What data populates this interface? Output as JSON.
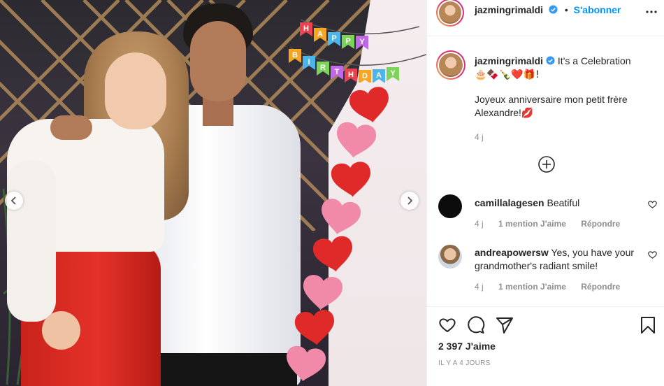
{
  "post": {
    "banner_letters": [
      "H",
      "A",
      "P",
      "P",
      "Y",
      " ",
      "B",
      "I",
      "R",
      "T",
      "H",
      "D",
      "A",
      "Y"
    ],
    "banner_colors": [
      "#e8434f",
      "#f6a623",
      "#4db6e8",
      "#7ed35a",
      "#c069e6",
      "#e8434f",
      "#f6a623",
      "#4db6e8",
      "#7ed35a",
      "#c069e6",
      "#e8434f",
      "#f6a623",
      "#4db6e8",
      "#7ed35a"
    ]
  },
  "header": {
    "username": "jazmingrimaldi",
    "separator": "•",
    "follow_label": "S'abonner"
  },
  "caption": {
    "username": "jazmingrimaldi",
    "line1": "It's a Celebration",
    "emojis": "🎂🍫🍾❤️🎁!",
    "line2": "Joyeux anniversaire mon petit frère Alexandre!💋",
    "time": "4 j"
  },
  "comments": [
    {
      "username": "camillalagesen",
      "text": "Beatiful",
      "time": "4 j",
      "likes": "1 mention J'aime",
      "reply": "Répondre"
    },
    {
      "username": "andreapowersw",
      "text": "Yes, you have your grandmother's radiant smile!",
      "time": "4 j",
      "likes": "1 mention J'aime",
      "reply": "Répondre"
    }
  ],
  "footer": {
    "likes": "2 397 J'aime",
    "date": "IL Y A 4 JOURS"
  },
  "colors": {
    "accent": "#0095f6",
    "verified": "#3897f0",
    "text": "#262626",
    "muted": "#8e8e8e"
  }
}
